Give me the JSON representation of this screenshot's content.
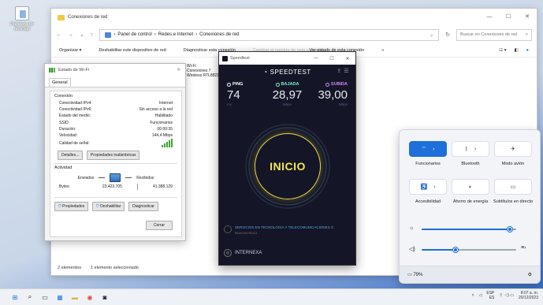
{
  "desktop": {
    "icon_label": "Papelera de reciclaje"
  },
  "explorer": {
    "title": "Conexiones de red",
    "path": [
      "Panel de control",
      "Redes e Internet",
      "Conexiones de red"
    ],
    "search_placeholder": "Buscar en Conexiones de red",
    "commands": [
      "Organizar ▾",
      "Deshabilitar este dispositivo de red",
      "Diagnosticar esta conexión",
      "Cambiar el nombre de esta conexión",
      "Ver estado de esta conexión",
      "»"
    ],
    "bg_item": [
      "Wi-Fi",
      "Conexiones 7",
      "Wireless RTL8821BE"
    ],
    "status_items": "2 elementos",
    "status_selected": "1 elemento seleccionado"
  },
  "wifi": {
    "title": "Estado de Wi-Fi",
    "tab": "General",
    "section_connection": "Conexión",
    "rows": [
      {
        "k": "Conectividad IPv4:",
        "v": "Internet"
      },
      {
        "k": "Conectividad IPv6:",
        "v": "Sin acceso a la red"
      },
      {
        "k": "Estado del medio:",
        "v": "Habilitado"
      },
      {
        "k": "SSID:",
        "v": "Funcionarios"
      },
      {
        "k": "Duración:",
        "v": "00:00:35"
      },
      {
        "k": "Velocidad:",
        "v": "144,4 Mbps"
      }
    ],
    "signal_label": "Calidad de señal:",
    "btn_details": "Detalles...",
    "btn_wireless": "Propiedades inalámbricas",
    "section_activity": "Actividad",
    "sent_label": "Enviados",
    "received_label": "Recibidos",
    "bytes_label": "Bytes:",
    "bytes_sent": "23.423.705",
    "bytes_received": "41.388.129",
    "btn_properties": "Propiedades",
    "btn_disable": "Deshabilitar",
    "btn_diagnose": "Diagnosticar",
    "btn_close": "Cerrar"
  },
  "speedtest": {
    "title": "Speedtest",
    "brand": "SPEEDTEST",
    "ping": {
      "label": "PING",
      "value": "74",
      "unit": "ms",
      "color": "#ffffff"
    },
    "download": {
      "label": "BAJADA",
      "value": "28,97",
      "unit": "Mbps",
      "color": "#7cf3c9"
    },
    "upload": {
      "label": "SUBIDA",
      "value": "39,00",
      "unit": "Mbps",
      "color": "#c98af5"
    },
    "start": "INICIO",
    "isp_name": "SERVICIOS EN TECNOLOGIA Y TELECOMUNICACIONES S",
    "isp_location": "Buenaventura",
    "server": "INTERNEXA"
  },
  "quick": {
    "tiles": [
      {
        "label": "Funcionarios",
        "state": "on"
      },
      {
        "label": "Bluetooth",
        "state": "off"
      },
      {
        "label": "Modo avión",
        "state": "off"
      },
      {
        "label": "Accesibilidad",
        "state": "off"
      },
      {
        "label": "Ahorro de energía",
        "state": "off"
      },
      {
        "label": "Subtítulos en directo",
        "state": "off"
      }
    ],
    "brightness": 0.93,
    "volume": 0.36,
    "battery": "79%"
  },
  "taskbar": {
    "lang": "ESP",
    "region": "ES",
    "time": "8:07 a. m.",
    "date": "20/12/2023"
  }
}
